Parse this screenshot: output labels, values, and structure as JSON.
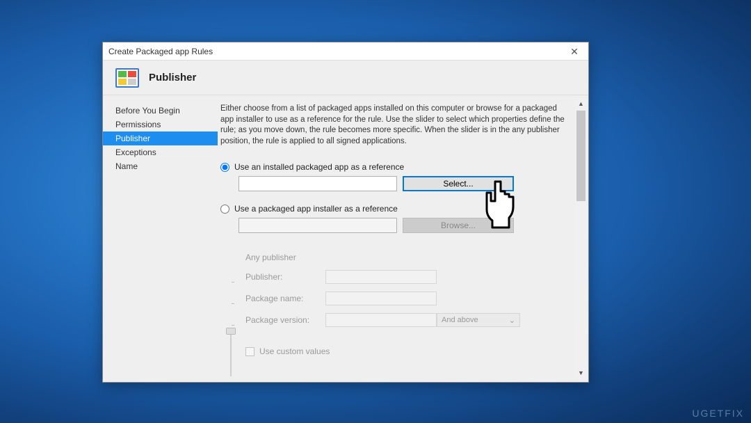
{
  "dialog": {
    "title": "Create Packaged app Rules",
    "header_title": "Publisher"
  },
  "sidebar": {
    "items": [
      {
        "label": "Before You Begin"
      },
      {
        "label": "Permissions"
      },
      {
        "label": "Publisher"
      },
      {
        "label": "Exceptions"
      },
      {
        "label": "Name"
      }
    ]
  },
  "content": {
    "intro": "Either choose from a list of packaged apps installed on this computer or browse for a packaged app installer to use as a reference for the rule. Use the slider to select which properties define the rule; as you move down, the rule becomes more specific. When the slider is in the any publisher position, the rule is applied to all signed applications.",
    "radio1_label": "Use an installed packaged app as a reference",
    "radio2_label": "Use a packaged app installer as a reference",
    "select_button": "Select...",
    "browse_button": "Browse...",
    "detail": {
      "any_publisher": "Any publisher",
      "publisher": "Publisher:",
      "package_name": "Package name:",
      "package_version": "Package version:",
      "and_above": "And above"
    },
    "use_custom": "Use custom values"
  },
  "watermark": "UGETFIX"
}
